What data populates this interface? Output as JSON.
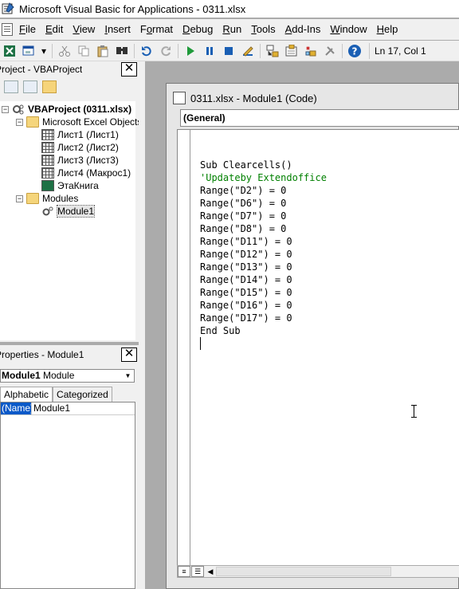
{
  "window": {
    "title": "Microsoft Visual Basic for Applications - 0311.xlsx"
  },
  "menu": {
    "items": [
      {
        "pre": "",
        "u": "F",
        "post": "ile"
      },
      {
        "pre": "",
        "u": "E",
        "post": "dit"
      },
      {
        "pre": "",
        "u": "V",
        "post": "iew"
      },
      {
        "pre": "",
        "u": "I",
        "post": "nsert"
      },
      {
        "pre": "F",
        "u": "o",
        "post": "rmat"
      },
      {
        "pre": "",
        "u": "D",
        "post": "ebug"
      },
      {
        "pre": "",
        "u": "R",
        "post": "un"
      },
      {
        "pre": "",
        "u": "T",
        "post": "ools"
      },
      {
        "pre": "",
        "u": "A",
        "post": "dd-Ins"
      },
      {
        "pre": "",
        "u": "W",
        "post": "indow"
      },
      {
        "pre": "",
        "u": "H",
        "post": "elp"
      }
    ]
  },
  "toolbar": {
    "position": "Ln 17, Col 1",
    "icons": [
      "excel-icon",
      "insert-userform-icon",
      "dropdown-arrow-icon",
      "cut-icon",
      "copy-icon",
      "paste-icon",
      "find-icon",
      "undo-icon",
      "redo-icon",
      "run-icon",
      "break-icon",
      "reset-icon",
      "design-mode-icon",
      "project-explorer-icon",
      "properties-window-icon",
      "object-browser-icon",
      "toolbox-icon",
      "help-icon"
    ]
  },
  "project_panel": {
    "title": "Project - VBAProject",
    "tree": {
      "project": "VBAProject (0311.xlsx)",
      "group_objects": "Microsoft Excel Objects",
      "sheets": [
        "Лист1 (Лист1)",
        "Лист2 (Лист2)",
        "Лист3 (Лист3)",
        "Лист4 (Макрос1)",
        "ЭтаКнига"
      ],
      "group_modules": "Modules",
      "module": "Module1"
    }
  },
  "properties_panel": {
    "title": "Properties - Module1",
    "object_name": "Module1",
    "object_type": "Module",
    "tabs": [
      "Alphabetic",
      "Categorized"
    ],
    "rows": [
      {
        "name": "(Name)",
        "value": "Module1"
      }
    ]
  },
  "code_window": {
    "title": "0311.xlsx - Module1 (Code)",
    "object_dropdown": "(General)",
    "lines": [
      {
        "text": "Sub Clearcells()",
        "kind": "code"
      },
      {
        "text": "'Updateby Extendoffice",
        "kind": "comment"
      },
      {
        "text": "Range(\"D2\") = 0",
        "kind": "code"
      },
      {
        "text": "Range(\"D6\") = 0",
        "kind": "code"
      },
      {
        "text": "Range(\"D7\") = 0",
        "kind": "code"
      },
      {
        "text": "Range(\"D8\") = 0",
        "kind": "code"
      },
      {
        "text": "Range(\"D11\") = 0",
        "kind": "code"
      },
      {
        "text": "Range(\"D12\") = 0",
        "kind": "code"
      },
      {
        "text": "Range(\"D13\") = 0",
        "kind": "code"
      },
      {
        "text": "Range(\"D14\") = 0",
        "kind": "code"
      },
      {
        "text": "Range(\"D15\") = 0",
        "kind": "code"
      },
      {
        "text": "Range(\"D16\") = 0",
        "kind": "code"
      },
      {
        "text": "Range(\"D17\") = 0",
        "kind": "code"
      },
      {
        "text": "End Sub",
        "kind": "code"
      }
    ]
  },
  "colors": {
    "comment": "#008000",
    "selection": "#0a59c8"
  }
}
